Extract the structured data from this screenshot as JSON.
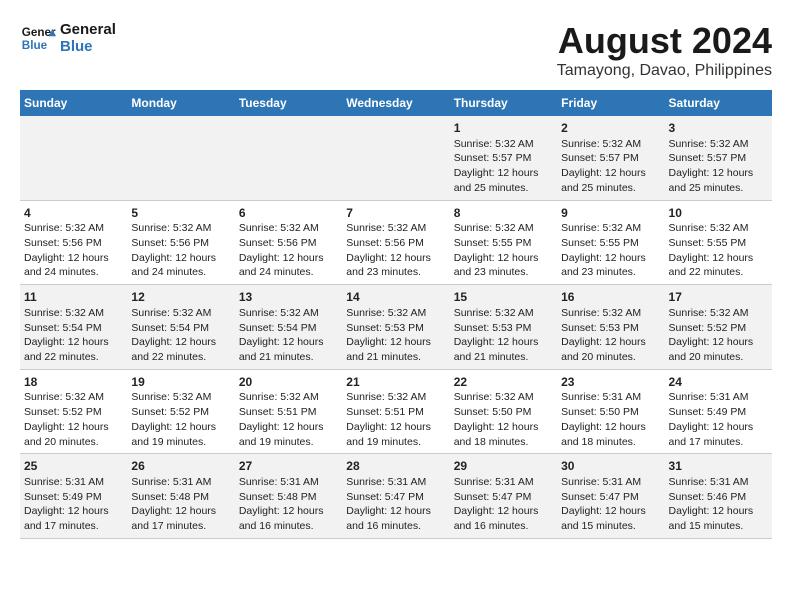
{
  "header": {
    "logo_line1": "General",
    "logo_line2": "Blue",
    "main_title": "August 2024",
    "subtitle": "Tamayong, Davao, Philippines"
  },
  "days_of_week": [
    "Sunday",
    "Monday",
    "Tuesday",
    "Wednesday",
    "Thursday",
    "Friday",
    "Saturday"
  ],
  "weeks": [
    [
      {
        "day": "",
        "text": ""
      },
      {
        "day": "",
        "text": ""
      },
      {
        "day": "",
        "text": ""
      },
      {
        "day": "",
        "text": ""
      },
      {
        "day": "1",
        "text": "Sunrise: 5:32 AM\nSunset: 5:57 PM\nDaylight: 12 hours\nand 25 minutes."
      },
      {
        "day": "2",
        "text": "Sunrise: 5:32 AM\nSunset: 5:57 PM\nDaylight: 12 hours\nand 25 minutes."
      },
      {
        "day": "3",
        "text": "Sunrise: 5:32 AM\nSunset: 5:57 PM\nDaylight: 12 hours\nand 25 minutes."
      }
    ],
    [
      {
        "day": "4",
        "text": "Sunrise: 5:32 AM\nSunset: 5:56 PM\nDaylight: 12 hours\nand 24 minutes."
      },
      {
        "day": "5",
        "text": "Sunrise: 5:32 AM\nSunset: 5:56 PM\nDaylight: 12 hours\nand 24 minutes."
      },
      {
        "day": "6",
        "text": "Sunrise: 5:32 AM\nSunset: 5:56 PM\nDaylight: 12 hours\nand 24 minutes."
      },
      {
        "day": "7",
        "text": "Sunrise: 5:32 AM\nSunset: 5:56 PM\nDaylight: 12 hours\nand 23 minutes."
      },
      {
        "day": "8",
        "text": "Sunrise: 5:32 AM\nSunset: 5:55 PM\nDaylight: 12 hours\nand 23 minutes."
      },
      {
        "day": "9",
        "text": "Sunrise: 5:32 AM\nSunset: 5:55 PM\nDaylight: 12 hours\nand 23 minutes."
      },
      {
        "day": "10",
        "text": "Sunrise: 5:32 AM\nSunset: 5:55 PM\nDaylight: 12 hours\nand 22 minutes."
      }
    ],
    [
      {
        "day": "11",
        "text": "Sunrise: 5:32 AM\nSunset: 5:54 PM\nDaylight: 12 hours\nand 22 minutes."
      },
      {
        "day": "12",
        "text": "Sunrise: 5:32 AM\nSunset: 5:54 PM\nDaylight: 12 hours\nand 22 minutes."
      },
      {
        "day": "13",
        "text": "Sunrise: 5:32 AM\nSunset: 5:54 PM\nDaylight: 12 hours\nand 21 minutes."
      },
      {
        "day": "14",
        "text": "Sunrise: 5:32 AM\nSunset: 5:53 PM\nDaylight: 12 hours\nand 21 minutes."
      },
      {
        "day": "15",
        "text": "Sunrise: 5:32 AM\nSunset: 5:53 PM\nDaylight: 12 hours\nand 21 minutes."
      },
      {
        "day": "16",
        "text": "Sunrise: 5:32 AM\nSunset: 5:53 PM\nDaylight: 12 hours\nand 20 minutes."
      },
      {
        "day": "17",
        "text": "Sunrise: 5:32 AM\nSunset: 5:52 PM\nDaylight: 12 hours\nand 20 minutes."
      }
    ],
    [
      {
        "day": "18",
        "text": "Sunrise: 5:32 AM\nSunset: 5:52 PM\nDaylight: 12 hours\nand 20 minutes."
      },
      {
        "day": "19",
        "text": "Sunrise: 5:32 AM\nSunset: 5:52 PM\nDaylight: 12 hours\nand 19 minutes."
      },
      {
        "day": "20",
        "text": "Sunrise: 5:32 AM\nSunset: 5:51 PM\nDaylight: 12 hours\nand 19 minutes."
      },
      {
        "day": "21",
        "text": "Sunrise: 5:32 AM\nSunset: 5:51 PM\nDaylight: 12 hours\nand 19 minutes."
      },
      {
        "day": "22",
        "text": "Sunrise: 5:32 AM\nSunset: 5:50 PM\nDaylight: 12 hours\nand 18 minutes."
      },
      {
        "day": "23",
        "text": "Sunrise: 5:31 AM\nSunset: 5:50 PM\nDaylight: 12 hours\nand 18 minutes."
      },
      {
        "day": "24",
        "text": "Sunrise: 5:31 AM\nSunset: 5:49 PM\nDaylight: 12 hours\nand 17 minutes."
      }
    ],
    [
      {
        "day": "25",
        "text": "Sunrise: 5:31 AM\nSunset: 5:49 PM\nDaylight: 12 hours\nand 17 minutes."
      },
      {
        "day": "26",
        "text": "Sunrise: 5:31 AM\nSunset: 5:48 PM\nDaylight: 12 hours\nand 17 minutes."
      },
      {
        "day": "27",
        "text": "Sunrise: 5:31 AM\nSunset: 5:48 PM\nDaylight: 12 hours\nand 16 minutes."
      },
      {
        "day": "28",
        "text": "Sunrise: 5:31 AM\nSunset: 5:47 PM\nDaylight: 12 hours\nand 16 minutes."
      },
      {
        "day": "29",
        "text": "Sunrise: 5:31 AM\nSunset: 5:47 PM\nDaylight: 12 hours\nand 16 minutes."
      },
      {
        "day": "30",
        "text": "Sunrise: 5:31 AM\nSunset: 5:47 PM\nDaylight: 12 hours\nand 15 minutes."
      },
      {
        "day": "31",
        "text": "Sunrise: 5:31 AM\nSunset: 5:46 PM\nDaylight: 12 hours\nand 15 minutes."
      }
    ]
  ]
}
